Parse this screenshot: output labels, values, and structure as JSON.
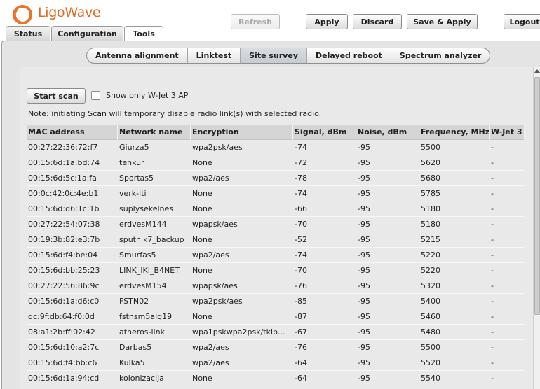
{
  "brand": {
    "name": "LigoWave",
    "accent": "#e06a1f"
  },
  "toolbar": {
    "refresh": "Refresh",
    "apply": "Apply",
    "discard": "Discard",
    "save_apply": "Save & Apply",
    "logout": "Logout"
  },
  "main_tabs": [
    {
      "label": "Status"
    },
    {
      "label": "Configuration"
    },
    {
      "label": "Tools",
      "active": true
    }
  ],
  "sub_tabs": [
    {
      "label": "Antenna alignment"
    },
    {
      "label": "Linktest"
    },
    {
      "label": "Site survey",
      "active": true
    },
    {
      "label": "Delayed reboot"
    },
    {
      "label": "Spectrum analyzer"
    }
  ],
  "survey": {
    "start_scan": "Start scan",
    "only_wjet_label": "Show only W-Jet 3 AP",
    "only_wjet_checked": false,
    "note": "Note: initiating Scan will temporary disable radio link(s) with selected radio.",
    "columns": [
      "MAC address",
      "Network name",
      "Encryption",
      "Signal, dBm",
      "Noise, dBm",
      "Frequency, MHz",
      "W-Jet 3"
    ],
    "rows": [
      [
        "00:27:22:36:72:f7",
        "Giurza5",
        "wpa2psk/aes",
        "-74",
        "-95",
        "5500",
        "-"
      ],
      [
        "00:15:6d:1a:bd:74",
        "tenkur",
        "None",
        "-72",
        "-95",
        "5620",
        "-"
      ],
      [
        "00:15:6d:5c:1a:fa",
        "Sportas5",
        "wpa2/aes",
        "-78",
        "-95",
        "5680",
        "-"
      ],
      [
        "00:0c:42:0c:4e:b1",
        "verk-iti",
        "None",
        "-74",
        "-95",
        "5785",
        "-"
      ],
      [
        "00:15:6d:d6:1c:1b",
        "suplysekelnes",
        "None",
        "-66",
        "-95",
        "5180",
        "-"
      ],
      [
        "00:27:22:54:07:38",
        "erdvesM144",
        "wpapsk/aes",
        "-70",
        "-95",
        "5180",
        "-"
      ],
      [
        "00:19:3b:82:e3:7b",
        "sputnik7_backup",
        "None",
        "-52",
        "-95",
        "5215",
        "-"
      ],
      [
        "00:15:6d:f4:be:04",
        "Smurfas5",
        "wpa2/aes",
        "-74",
        "-95",
        "5220",
        "-"
      ],
      [
        "00:15:6d:bb:25:23",
        "LINK_IKI_B4NET",
        "None",
        "-70",
        "-95",
        "5220",
        "-"
      ],
      [
        "00:27:22:56:86:9c",
        "erdvesM154",
        "wpapsk/aes",
        "-76",
        "-95",
        "5320",
        "-"
      ],
      [
        "00:15:6d:1a:d6:c0",
        "FSTN02",
        "wpa2psk/aes",
        "-85",
        "-95",
        "5400",
        "-"
      ],
      [
        "dc:9f:db:64:f0:0d",
        "fstnsm5alg19",
        "None",
        "-87",
        "-95",
        "5460",
        "-"
      ],
      [
        "08:a1:2b:ff:02:42",
        "atheros-link",
        "wpa1pskwpa2psk/tkip...",
        "-67",
        "-95",
        "5480",
        "-"
      ],
      [
        "00:15:6d:10:a2:7c",
        "Darbas5",
        "wpa2/aes",
        "-76",
        "-95",
        "5500",
        "-"
      ],
      [
        "00:15:6d:f4:bb:c6",
        "Kulka5",
        "wpa2/aes",
        "-64",
        "-95",
        "5520",
        "-"
      ],
      [
        "00:15:6d:1a:94:cd",
        "kolonizacija",
        "None",
        "-64",
        "-95",
        "5540",
        "-"
      ]
    ]
  }
}
